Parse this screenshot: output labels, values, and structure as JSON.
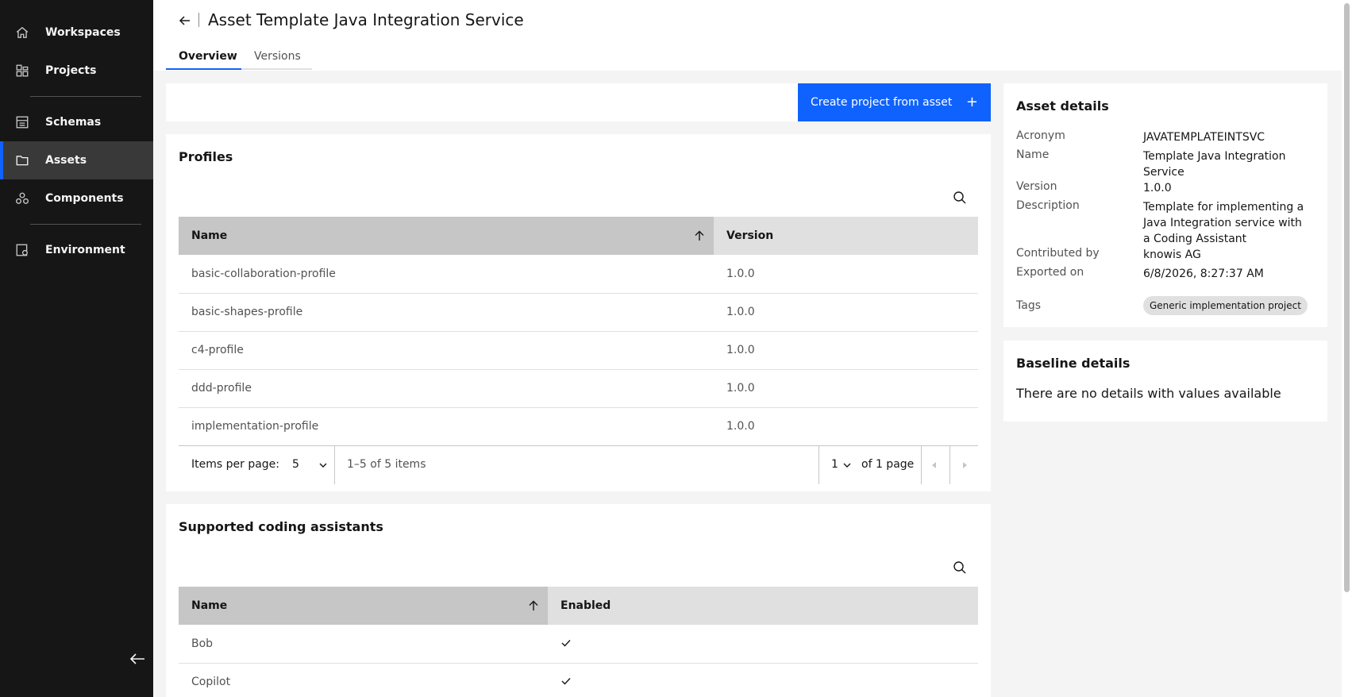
{
  "sidebar": {
    "items": [
      {
        "label": "Workspaces",
        "icon": "home-icon"
      },
      {
        "label": "Projects",
        "icon": "projects-icon"
      },
      {
        "label": "Schemas",
        "icon": "schemas-icon"
      },
      {
        "label": "Assets",
        "icon": "folder-icon",
        "active": true
      },
      {
        "label": "Components",
        "icon": "components-icon"
      },
      {
        "label": "Environment",
        "icon": "environment-icon"
      }
    ],
    "collapse_icon": "arrow-left-icon"
  },
  "header": {
    "back_icon": "arrow-left-icon",
    "title": "Asset Template Java Integration Service",
    "tabs": [
      {
        "label": "Overview",
        "selected": true
      },
      {
        "label": "Versions",
        "selected": false
      }
    ]
  },
  "toolbar": {
    "create_button_label": "Create project from asset",
    "create_button_icon": "+"
  },
  "profiles": {
    "title": "Profiles",
    "columns": {
      "name": "Name",
      "version": "Version"
    },
    "rows": [
      {
        "name": "basic-collaboration-profile",
        "version": "1.0.0"
      },
      {
        "name": "basic-shapes-profile",
        "version": "1.0.0"
      },
      {
        "name": "c4-profile",
        "version": "1.0.0"
      },
      {
        "name": "ddd-profile",
        "version": "1.0.0"
      },
      {
        "name": "implementation-profile",
        "version": "1.0.0"
      }
    ],
    "pagination": {
      "items_per_page_label": "Items per page:",
      "items_per_page_value": "5",
      "range_text": "1–5 of 5 items",
      "page_value": "1",
      "page_total_text": "of 1 page"
    }
  },
  "coding_assistants": {
    "title": "Supported coding assistants",
    "columns": {
      "name": "Name",
      "enabled": "Enabled"
    },
    "rows": [
      {
        "name": "Bob",
        "enabled": true
      },
      {
        "name": "Copilot",
        "enabled": true
      }
    ]
  },
  "asset_details": {
    "title": "Asset details",
    "fields": [
      {
        "label": "Acronym",
        "value": "JAVATEMPLATEINTSVC"
      },
      {
        "label": "Name",
        "value": "Template Java Integration Service"
      },
      {
        "label": "Version",
        "value": "1.0.0"
      },
      {
        "label": "Description",
        "value": "Template for implementing a Java Integration service with a Coding Assistant"
      },
      {
        "label": "Contributed by",
        "value": "knowis AG"
      },
      {
        "label": "Exported on",
        "value": "6/8/2026, 8:27:37 AM"
      }
    ],
    "tags_label": "Tags",
    "tags": [
      "Generic implementation project"
    ]
  },
  "baseline_details": {
    "title": "Baseline details",
    "empty_text": "There are no details with values available"
  },
  "colors": {
    "sidebar_bg": "#161616",
    "accent": "#0f62fe",
    "header_bg": "#ffffff",
    "page_bg": "#f4f4f4"
  }
}
